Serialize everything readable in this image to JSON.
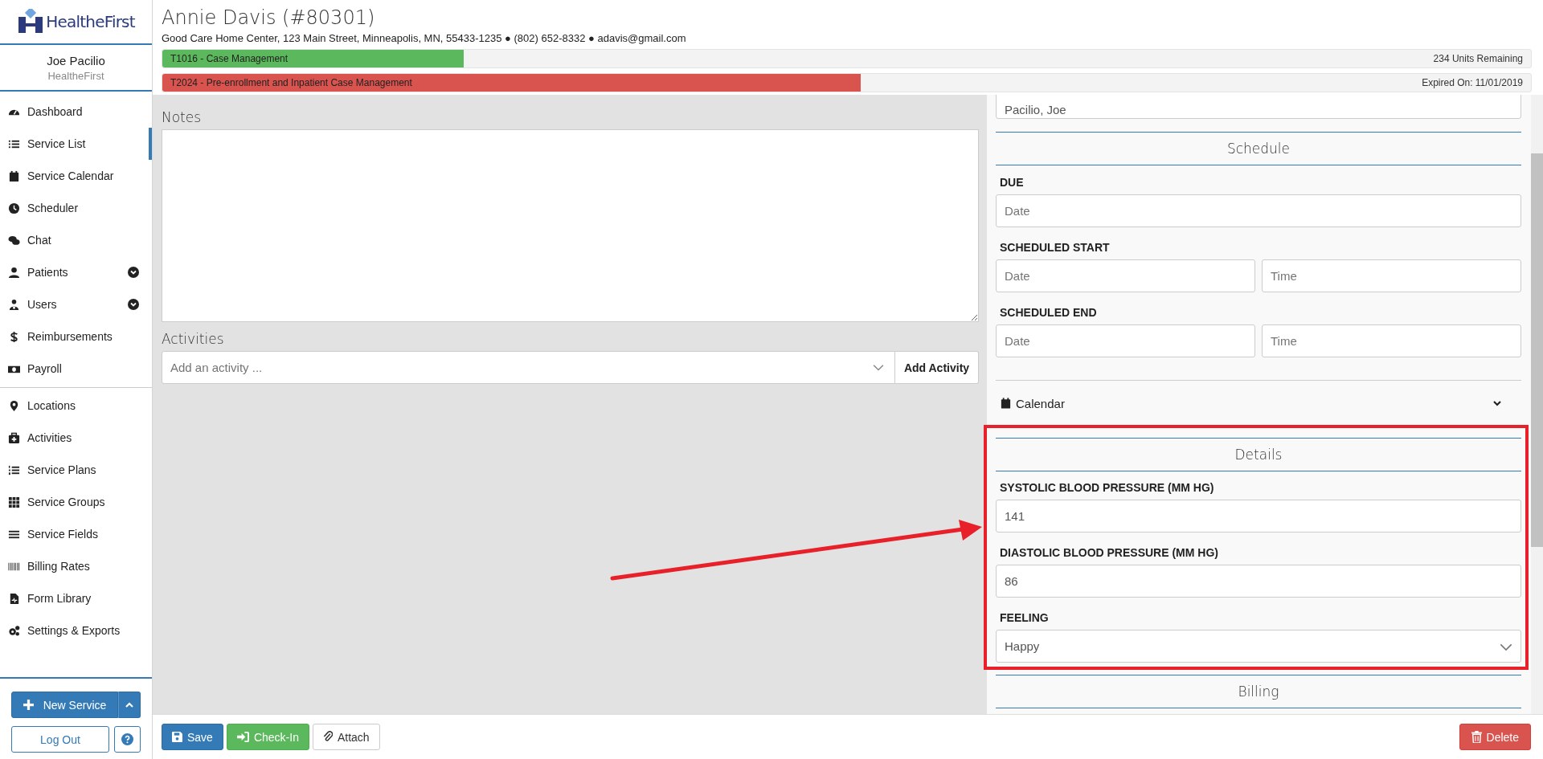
{
  "logo": {
    "text": "HealtheFirst"
  },
  "user": {
    "name": "Joe Pacilio",
    "org": "HealtheFirst"
  },
  "sidebar": {
    "groups": [
      [
        {
          "label": "Dashboard",
          "kind": "link",
          "selected": false
        },
        {
          "label": "Service List",
          "kind": "link",
          "selected": true
        },
        {
          "label": "Service Calendar",
          "kind": "link",
          "selected": false
        },
        {
          "label": "Scheduler",
          "kind": "link",
          "selected": false
        },
        {
          "label": "Chat",
          "kind": "link",
          "selected": false
        },
        {
          "label": "Patients",
          "kind": "menu",
          "selected": false,
          "expanded": false
        },
        {
          "label": "Users",
          "kind": "menu",
          "selected": false,
          "expanded": false
        },
        {
          "label": "Reimbursements",
          "kind": "link",
          "selected": false
        },
        {
          "label": "Payroll",
          "kind": "link",
          "selected": false
        }
      ],
      [
        {
          "label": "Locations",
          "kind": "link",
          "selected": false
        },
        {
          "label": "Activities",
          "kind": "link",
          "selected": false
        },
        {
          "label": "Service Plans",
          "kind": "link",
          "selected": false
        },
        {
          "label": "Service Groups",
          "kind": "link",
          "selected": false
        },
        {
          "label": "Service Fields",
          "kind": "link",
          "selected": false
        },
        {
          "label": "Billing Rates",
          "kind": "link",
          "selected": false
        },
        {
          "label": "Form Library",
          "kind": "link",
          "selected": false
        },
        {
          "label": "Settings & Exports",
          "kind": "link",
          "selected": false
        }
      ]
    ]
  },
  "new_service_button": "New Service",
  "logout_button": "Log Out",
  "patient": {
    "name": "Annie Davis (#80301)",
    "details": "Good Care Home Center, 123 Main Street, Minneapolis, MN, 55433-1235 ● (802) 652-8332 ● adavis@gmail.com"
  },
  "authorizations": [
    {
      "label": "T1016 - Case Management",
      "level": 0.22,
      "color": "#5cb85c",
      "note": "234 Units Remaining"
    },
    {
      "label": "T2024 - Pre-enrollment and Inpatient Case Management",
      "level": 0.51,
      "color": "#d9534f",
      "note": "Expired On: 11/01/2019"
    }
  ],
  "notes": {
    "label": "Notes"
  },
  "activities": {
    "label": "Activities",
    "placeholder": "Add an activity ...",
    "button": "Add Activity"
  },
  "assignee": {
    "value": "Pacilio, Joe"
  },
  "schedule": {
    "title": "Schedule",
    "fields": [
      {
        "label": "DUE",
        "inputs": [
          {
            "placeholder": "Date"
          }
        ]
      },
      {
        "label": "SCHEDULED START",
        "inputs": [
          {
            "placeholder": "Date"
          },
          {
            "placeholder": "Time"
          }
        ]
      },
      {
        "label": "SCHEDULED END",
        "inputs": [
          {
            "placeholder": "Date"
          },
          {
            "placeholder": "Time"
          }
        ]
      }
    ]
  },
  "calendar": {
    "label": "Calendar",
    "expanded": false
  },
  "details": {
    "title": "Details",
    "fields": [
      {
        "label": "SYSTOLIC BLOOD PRESSURE (MM HG)",
        "kind": "text",
        "value": "141"
      },
      {
        "label": "DIASTOLIC BLOOD PRESSURE (MM HG)",
        "kind": "text",
        "value": "86"
      },
      {
        "label": "FEELING",
        "kind": "select",
        "value": "Happy"
      }
    ]
  },
  "billing": {
    "title": "Billing"
  },
  "footer": {
    "buttons": [
      {
        "label": "Save",
        "kind": "primary"
      },
      {
        "label": "Check-In",
        "kind": "success"
      },
      {
        "label": "Attach",
        "kind": "default"
      }
    ],
    "delete": "Delete"
  }
}
